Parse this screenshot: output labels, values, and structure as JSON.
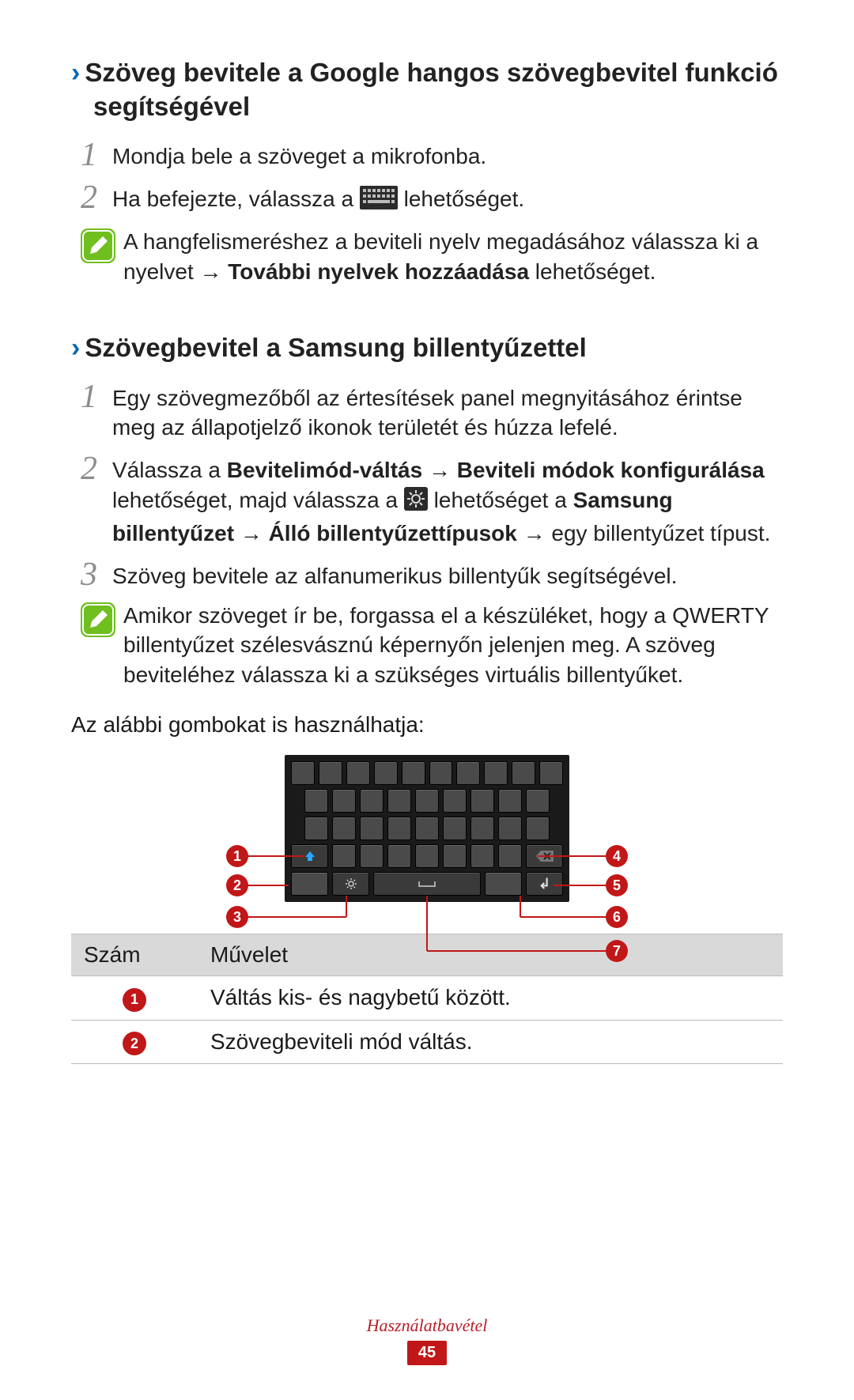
{
  "section1": {
    "heading": "Szöveg bevitele a Google hangos szövegbevitel funkció segítségével",
    "step1": "Mondja bele a szöveget a mikrofonba.",
    "step2_a": "Ha befejezte, válassza a ",
    "step2_b": " lehetőséget.",
    "tip_a": "A hangfelismeréshez a beviteli nyelv megadásához válassza ki a nyelvet → ",
    "tip_bold": "További nyelvek hozzáadása",
    "tip_b": " lehetőséget."
  },
  "section2": {
    "heading": "Szövegbevitel a Samsung billentyűzettel",
    "step1": "Egy szövegmezőből az értesítések panel megnyitásához érintse meg az állapotjelző ikonok területét és húzza lefelé.",
    "step2_parts": {
      "a": "Válassza a ",
      "b": "Bevitelimód-váltás",
      "c": " → ",
      "d": "Beviteli módok konfigurálása",
      "e": " lehetőséget, majd válassza a ",
      "f": " lehetőséget a ",
      "g": "Samsung billentyűzet",
      "h": " → ",
      "i": "Álló billentyűzettípusok",
      "j": " → egy billentyűzet típust."
    },
    "step3": "Szöveg bevitele az alfanumerikus billentyűk segítségével.",
    "tip": "Amikor szöveget ír be, forgassa el a készüléket, hogy a QWERTY billentyűzet szélesvásznú képernyőn jelenjen meg. A szöveg beviteléhez válassza ki a szükséges virtuális billentyűket."
  },
  "mid_text": "Az alábbi gombokat is használhatja:",
  "callouts": {
    "c1": "1",
    "c2": "2",
    "c3": "3",
    "c4": "4",
    "c5": "5",
    "c6": "6",
    "c7": "7"
  },
  "table": {
    "h1": "Szám",
    "h2": "Művelet",
    "rows": [
      {
        "num": "1",
        "text": "Váltás kis- és nagybetű között."
      },
      {
        "num": "2",
        "text": "Szövegbeviteli mód váltás."
      }
    ]
  },
  "footer": {
    "label": "Használatbavétel",
    "page": "45"
  },
  "step_numbers": {
    "one": "1",
    "two": "2",
    "three": "3"
  }
}
